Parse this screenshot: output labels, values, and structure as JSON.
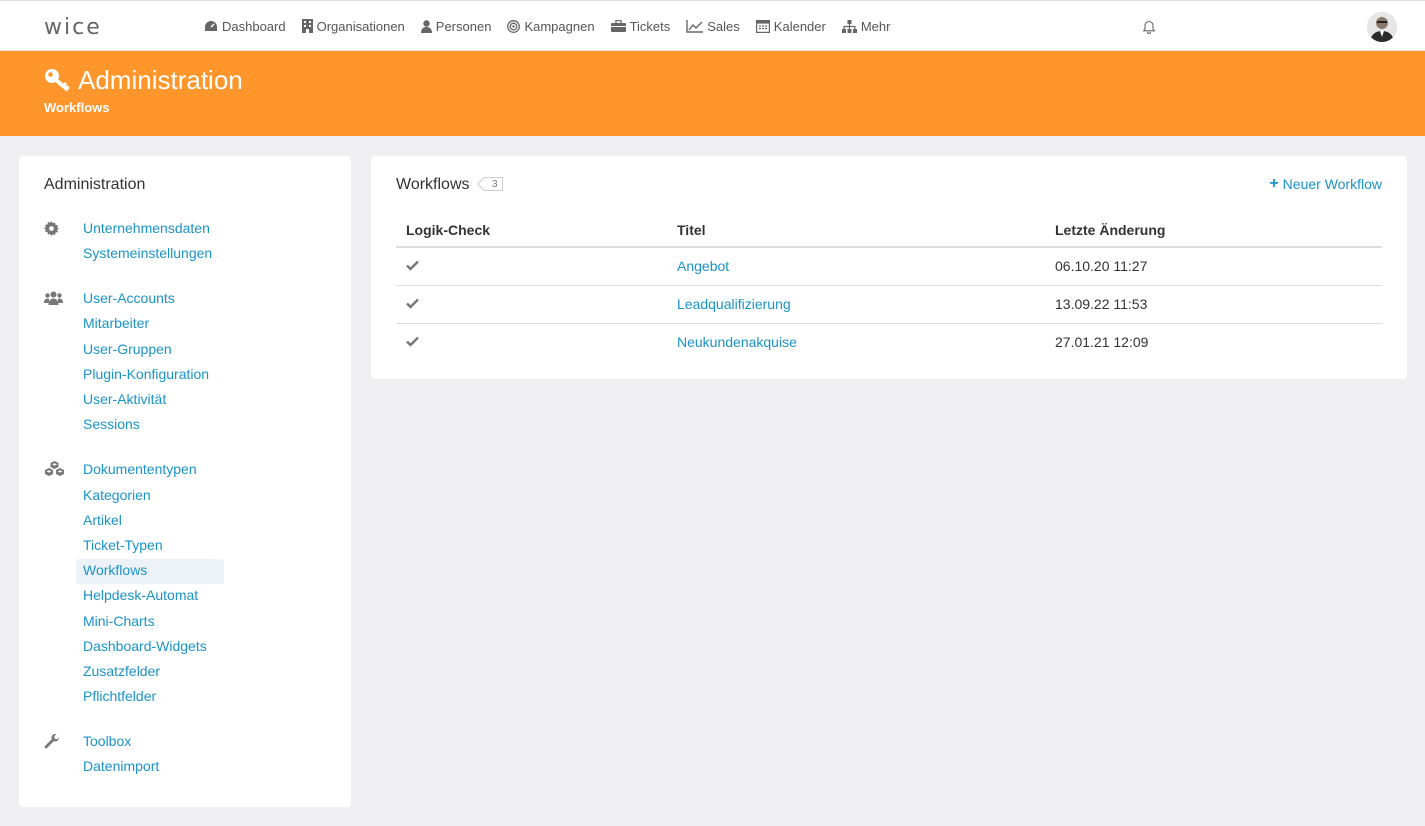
{
  "brand": {
    "logo_text": "wice"
  },
  "nav": {
    "items": [
      {
        "label": "Dashboard",
        "icon": "dashboard-icon"
      },
      {
        "label": "Organisationen",
        "icon": "building-icon"
      },
      {
        "label": "Personen",
        "icon": "person-icon"
      },
      {
        "label": "Kampagnen",
        "icon": "target-icon"
      },
      {
        "label": "Tickets",
        "icon": "briefcase-icon"
      },
      {
        "label": "Sales",
        "icon": "line-chart-icon"
      },
      {
        "label": "Kalender",
        "icon": "calendar-icon"
      },
      {
        "label": "Mehr",
        "icon": "sitemap-icon"
      }
    ]
  },
  "header": {
    "title": "Administration",
    "subtitle": "Workflows",
    "bg_color": "#ff962b"
  },
  "sidebar": {
    "title": "Administration",
    "groups": [
      {
        "icon": "gear-icon",
        "links": [
          "Unternehmensdaten",
          "Systemeinstellungen"
        ]
      },
      {
        "icon": "users-icon",
        "links": [
          "User-Accounts",
          "Mitarbeiter",
          "User-Gruppen",
          "Plugin-Konfiguration",
          "User-Aktivität",
          "Sessions"
        ]
      },
      {
        "icon": "cubes-icon",
        "links": [
          "Dokumententypen",
          "Kategorien",
          "Artikel",
          "Ticket-Typen",
          "Workflows",
          "Helpdesk-Automat",
          "Mini-Charts",
          "Dashboard-Widgets",
          "Zusatzfelder",
          "Pflichtfelder"
        ]
      },
      {
        "icon": "wrench-icon",
        "links": [
          "Toolbox",
          "Datenimport"
        ]
      }
    ],
    "active": "Workflows"
  },
  "main": {
    "title": "Workflows",
    "count": "3",
    "new_button": "Neuer Workflow",
    "columns": [
      "Logik-Check",
      "Titel",
      "Letzte Änderung"
    ],
    "rows": [
      {
        "check": true,
        "title": "Angebot",
        "date": "06.10.20 11:27"
      },
      {
        "check": true,
        "title": "Leadqualifizierung",
        "date": "13.09.22 11:53"
      },
      {
        "check": true,
        "title": "Neukundenakquise",
        "date": "27.01.21 12:09"
      }
    ]
  }
}
